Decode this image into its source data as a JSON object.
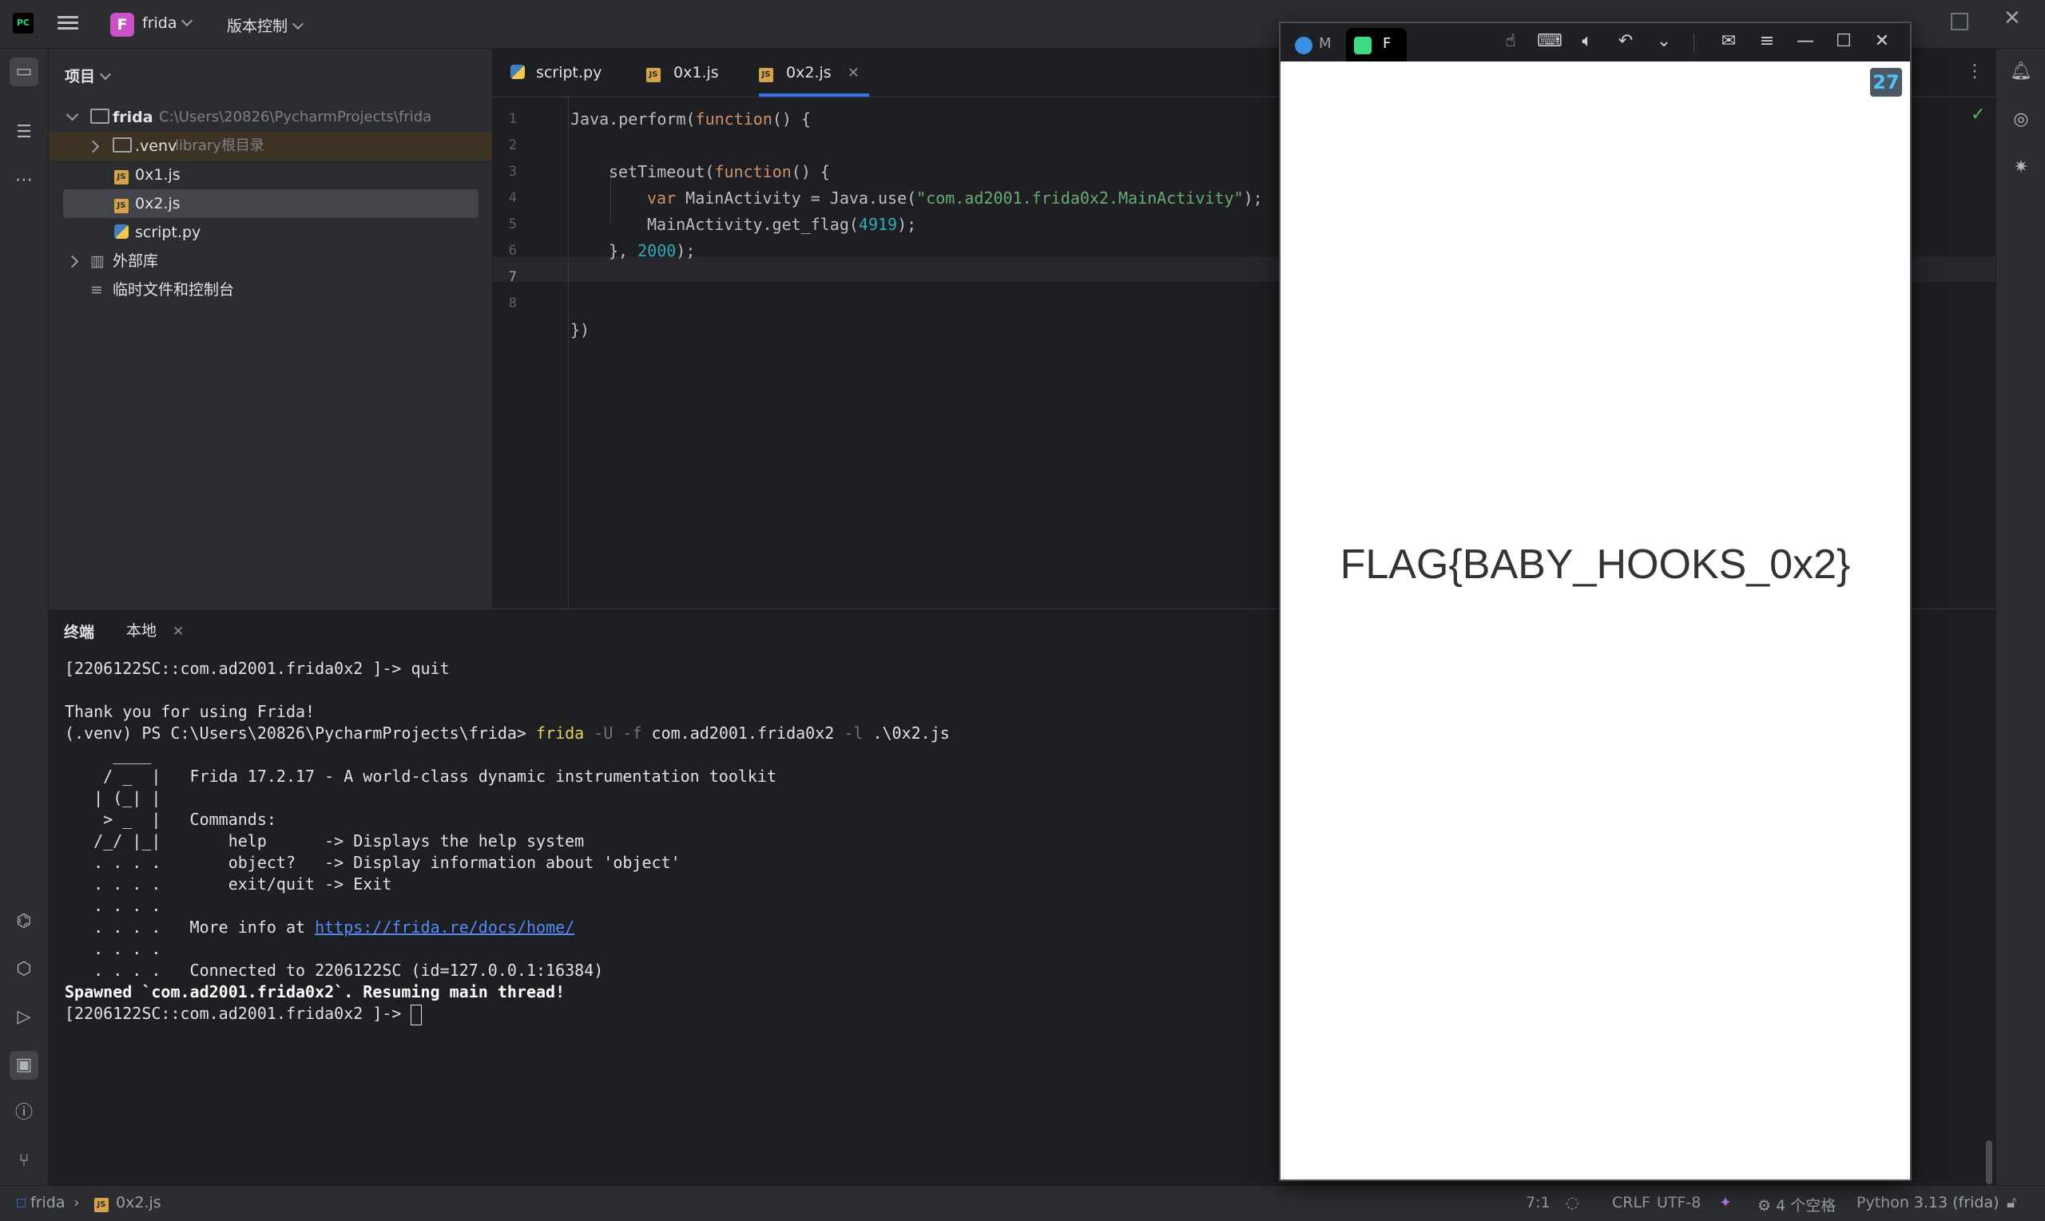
{
  "titlebar": {
    "logo": "PC",
    "project_badge": "F",
    "project_name": "frida",
    "vcs_label": "版本控制"
  },
  "project_panel": {
    "title": "项目",
    "root": {
      "name": "frida",
      "path": "C:\\Users\\20826\\PycharmProjects\\frida"
    },
    "items": [
      {
        "name": ".venv",
        "note": "library根目录"
      },
      {
        "name": "0x1.js"
      },
      {
        "name": "0x2.js"
      },
      {
        "name": "script.py"
      },
      {
        "name": "外部库"
      },
      {
        "name": "临时文件和控制台"
      }
    ]
  },
  "editor": {
    "tabs": [
      {
        "label": "script.py"
      },
      {
        "label": "0x1.js"
      },
      {
        "label": "0x2.js",
        "active": true
      }
    ],
    "line_numbers": [
      "1",
      "2",
      "3",
      "4",
      "5",
      "6",
      "7",
      "8"
    ],
    "code": {
      "l1_a": "Java.perform(",
      "l1_kw": "function",
      "l1_b": "() {",
      "l3_a": "setTimeout(",
      "l3_kw": "function",
      "l3_b": "() {",
      "l4_kw": "var",
      "l4_a": " MainActivity = Java.use(",
      "l4_str": "\"com.ad2001.frida0x2.MainActivity\"",
      "l4_b": ");",
      "l5_a": "MainActivity.get_flag(",
      "l5_num": "4919",
      "l5_b": ");",
      "l6_a": "}, ",
      "l6_num": "2000",
      "l6_b": ");",
      "l8": "})"
    }
  },
  "terminal": {
    "title": "终端",
    "tab": "本地",
    "lines": {
      "l1": "[2206122SC::com.ad2001.frida0x2 ]-> quit",
      "l2": "Thank you for using Frida!",
      "l3_prompt": "(.venv) PS C:\\Users\\20826\\PycharmProjects\\frida> ",
      "l3_cmd": "frida",
      "l3_u": " -U -f",
      "l3_pkg": " com.ad2001.frida0x2",
      "l3_l": " -l",
      "l3_file": " .\\0x2.js",
      "a1": "     ____",
      "a2": "    / _  |   Frida 17.2.17 - A world-class dynamic instrumentation toolkit",
      "a3": "   | (_| |",
      "a4": "    > _  |   Commands:",
      "a5": "   /_/ |_|       help      -> Displays the help system",
      "a6": "   . . . .       object?   -> Display information about 'object'",
      "a7": "   . . . .       exit/quit -> Exit",
      "a8": "   . . . .",
      "a9_pre": "   . . . .   More info at ",
      "a9_link": "https://frida.re/docs/home/",
      "a10": "   . . . .",
      "a11": "   . . . .   Connected to 2206122SC (id=127.0.0.1:16384)",
      "spawned": "Spawned `com.ad2001.frida0x2`. Resuming main thread!",
      "prompt": "[2206122SC::com.ad2001.frida0x2 ]-> "
    }
  },
  "statusbar": {
    "crumb_project": "frida",
    "crumb_file": "0x2.js",
    "position": "7:1",
    "line_sep": "CRLF",
    "encoding": "UTF-8",
    "indent": "4 个空格",
    "interpreter": "Python 3.13 (frida)"
  },
  "emulator": {
    "tab1_label": "M",
    "tab2_label": "F",
    "badge": "27",
    "flag_text": "FLAG{BABY_HOOKS_0x2}"
  }
}
